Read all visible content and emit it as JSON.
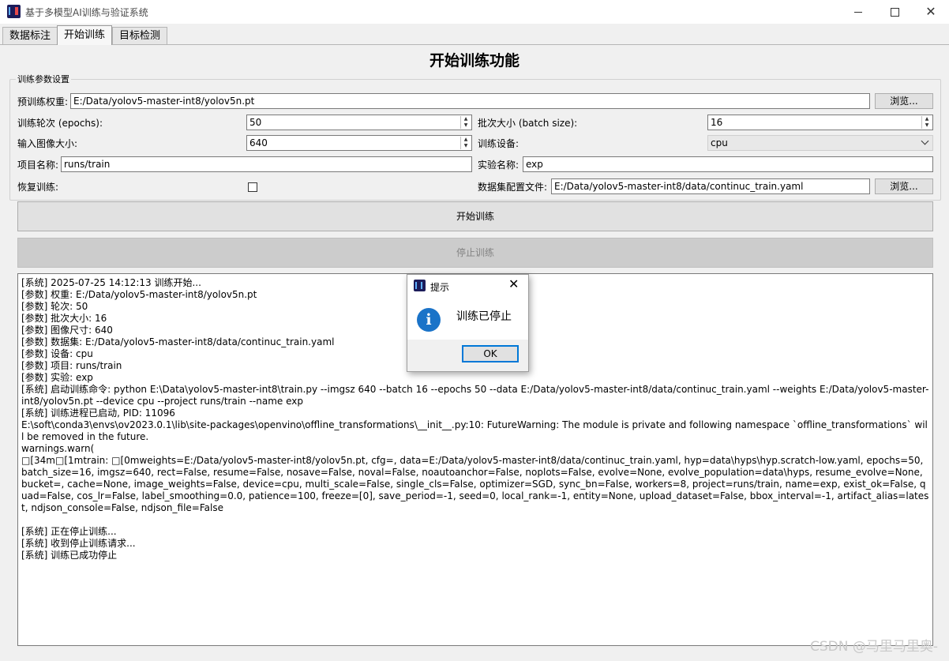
{
  "window": {
    "title": "基于多模型AI训练与验证系统",
    "min_icon": "minimize-icon",
    "max_icon": "maximize-icon",
    "close_glyph": "✕"
  },
  "tabs": [
    "数据标注",
    "开始训练",
    "目标检测"
  ],
  "active_tab": 1,
  "page_title": "开始训练功能",
  "params": {
    "group_title": "训练参数设置",
    "weights_label": "预训练权重:",
    "weights_value": "E:/Data/yolov5-master-int8/yolov5n.pt",
    "browse_label": "浏览...",
    "epochs_label": "训练轮次 (epochs):",
    "epochs_value": "50",
    "batch_label": "批次大小 (batch size):",
    "batch_value": "16",
    "imgsz_label": "输入图像大小:",
    "imgsz_value": "640",
    "device_label": "训练设备:",
    "device_value": "cpu",
    "project_label": "项目名称:",
    "project_value": "runs/train",
    "exp_label": "实验名称:",
    "exp_value": "exp",
    "resume_label": "恢复训练:",
    "resume_checked": false,
    "dataset_label": "数据集配置文件:",
    "dataset_value": "E:/Data/yolov5-master-int8/data/continuc_train.yaml"
  },
  "buttons": {
    "start": "开始训练",
    "stop": "停止训练"
  },
  "log_lines": [
    "[系统] 2025-07-25 14:12:13 训练开始...",
    "[参数] 权重: E:/Data/yolov5-master-int8/yolov5n.pt",
    "[参数] 轮次: 50",
    "[参数] 批次大小: 16",
    "[参数] 图像尺寸: 640",
    "[参数] 数据集: E:/Data/yolov5-master-int8/data/continuc_train.yaml",
    "[参数] 设备: cpu",
    "[参数] 项目: runs/train",
    "[参数] 实验: exp",
    "[系统] 启动训练命令: python E:\\Data\\yolov5-master-int8\\train.py --imgsz 640 --batch 16 --epochs 50 --data E:/Data/yolov5-master-int8/data/continuc_train.yaml --weights E:/Data/yolov5-master-int8/yolov5n.pt --device cpu --project runs/train --name exp",
    "[系统] 训练进程已启动, PID: 11096",
    "E:\\soft\\conda3\\envs\\ov2023.0.1\\lib\\site-packages\\openvino\\offline_transformations\\__init__.py:10: FutureWarning: The module is private and following namespace `offline_transformations` will be removed in the future.",
    "warnings.warn(",
    "□[34m□[1mtrain: □[0mweights=E:/Data/yolov5-master-int8/yolov5n.pt, cfg=, data=E:/Data/yolov5-master-int8/data/continuc_train.yaml, hyp=data\\hyps\\hyp.scratch-low.yaml, epochs=50, batch_size=16, imgsz=640, rect=False, resume=False, nosave=False, noval=False, noautoanchor=False, noplots=False, evolve=None, evolve_population=data\\hyps, resume_evolve=None, bucket=, cache=None, image_weights=False, device=cpu, multi_scale=False, single_cls=False, optimizer=SGD, sync_bn=False, workers=8, project=runs/train, name=exp, exist_ok=False, quad=False, cos_lr=False, label_smoothing=0.0, patience=100, freeze=[0], save_period=-1, seed=0, local_rank=-1, entity=None, upload_dataset=False, bbox_interval=-1, artifact_alias=latest, ndjson_console=False, ndjson_file=False",
    "",
    "[系统] 正在停止训练...",
    "[系统] 收到停止训练请求...",
    "[系统] 训练已成功停止"
  ],
  "dialog": {
    "title": "提示",
    "message": "训练已停止",
    "ok": "OK",
    "icon": "info-icon",
    "icon_glyph": "i",
    "close_glyph": "✕"
  },
  "watermark": "CSDN @马里马里奥-"
}
